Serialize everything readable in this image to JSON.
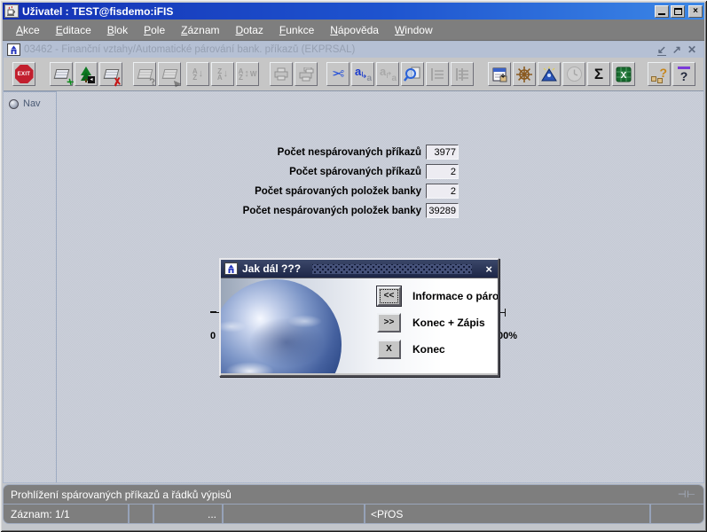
{
  "window": {
    "title": "Uživatel : TEST@fisdemo:iFIS",
    "close_glyph": "×",
    "controls": [
      "minimize-icon",
      "maximize-icon",
      "close-icon"
    ]
  },
  "menu": {
    "items": [
      {
        "label": "Akce"
      },
      {
        "label": "Editace"
      },
      {
        "label": "Blok"
      },
      {
        "label": "Pole"
      },
      {
        "label": "Záznam"
      },
      {
        "label": "Dotaz"
      },
      {
        "label": "Funkce"
      },
      {
        "label": "Nápověda"
      },
      {
        "label": "Window"
      }
    ]
  },
  "mdi_window": {
    "title": "03462 - Finanční vztahy/Automatické párování bank. příkazů (EKPRSAL)",
    "controls": [
      "minimize-icon",
      "restore-icon",
      "close-icon"
    ]
  },
  "toolbar": {
    "exit_label": "EXIT",
    "sigma_glyph": "Σ",
    "help_glyph": "?",
    "item_help_glyph": "?",
    "excel_glyph": "X",
    "icons": [
      {
        "name": "exit",
        "enabled": true
      },
      {
        "name": "insert-record",
        "enabled": true
      },
      {
        "name": "duplicate-record",
        "enabled": true
      },
      {
        "name": "delete-record",
        "enabled": true
      },
      {
        "name": "enter-query",
        "enabled": false
      },
      {
        "name": "execute-query",
        "enabled": false
      },
      {
        "name": "sort-ascending",
        "enabled": false
      },
      {
        "name": "sort-descending",
        "enabled": false
      },
      {
        "name": "sort-reset",
        "enabled": false
      },
      {
        "name": "print",
        "enabled": false
      },
      {
        "name": "print-all",
        "enabled": false
      },
      {
        "name": "cut",
        "enabled": true
      },
      {
        "name": "copy",
        "enabled": true
      },
      {
        "name": "paste",
        "enabled": false
      },
      {
        "name": "zoom-find",
        "enabled": true
      },
      {
        "name": "detail-first",
        "enabled": false
      },
      {
        "name": "detail-last",
        "enabled": false
      },
      {
        "name": "form-detail",
        "enabled": true
      },
      {
        "name": "navigator-helm",
        "enabled": true
      },
      {
        "name": "wizard-prism",
        "enabled": true
      },
      {
        "name": "clock",
        "enabled": false
      },
      {
        "name": "sum-sigma",
        "enabled": true
      },
      {
        "name": "export-excel",
        "enabled": true
      },
      {
        "name": "item-help",
        "enabled": true
      },
      {
        "name": "help",
        "enabled": true
      }
    ]
  },
  "nav": {
    "tab_label": "Nav"
  },
  "form": {
    "fields": [
      {
        "label": "Počet nespárovaných příkazů",
        "value": "3977"
      },
      {
        "label": "Počet spárovaných příkazů",
        "value": "2"
      },
      {
        "label": "Počet spárovaných položek banky",
        "value": "2"
      },
      {
        "label": "Počet nespárovaných položek banky",
        "value": "39289"
      }
    ]
  },
  "progress_scale": {
    "left_label": "0",
    "right_label": "00%"
  },
  "dialog": {
    "title": "Jak dál ???",
    "close_glyph": "×",
    "buttons": [
      {
        "glyph": "<<",
        "label": "Informace o párování",
        "focused": true
      },
      {
        "glyph": ">>",
        "label": "Konec + Zápis",
        "focused": false
      },
      {
        "glyph": "X",
        "label": "Konec",
        "focused": false
      }
    ]
  },
  "status": {
    "message": "Prohlížení spárovaných příkazů a řádků výpisů",
    "record": "Záznam: 1/1",
    "more": "...",
    "mode": "<PřOS"
  }
}
